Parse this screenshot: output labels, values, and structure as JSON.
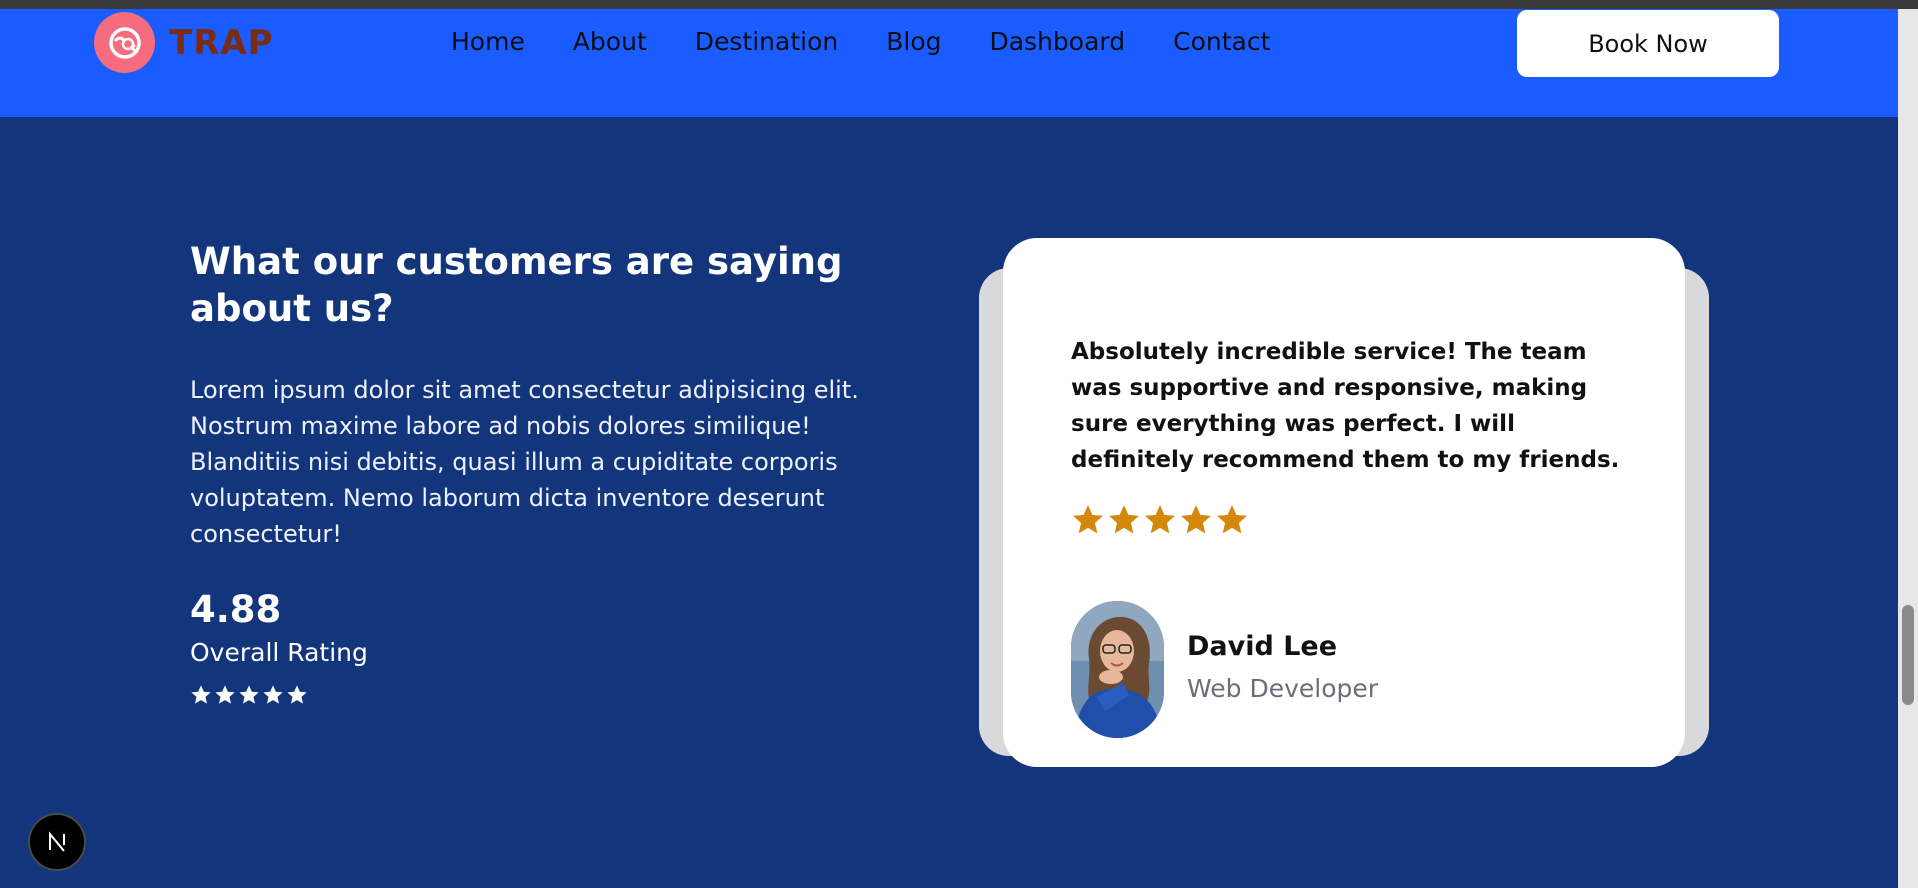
{
  "navbar": {
    "brand": "TRAP",
    "links": [
      "Home",
      "About",
      "Destination",
      "Blog",
      "Dashboard",
      "Contact"
    ],
    "cta": "Book Now"
  },
  "testimonials": {
    "heading": "What our customers are saying about us?",
    "description": "Lorem ipsum dolor sit amet consectetur adipisicing elit. Nostrum maxime labore ad nobis dolores similique! Blanditiis nisi debitis, quasi illum a cupiditate corporis voluptatem. Nemo laborum dicta inventore deserunt consectetur!",
    "rating": "4.88",
    "rating_label": "Overall Rating",
    "rating_stars": 5,
    "review": {
      "quote": "Absolutely incredible service! The team was supportive and responsive, making sure everything was perfect. I will definitely recommend them to my friends.",
      "stars": 5,
      "name": "David Lee",
      "role": "Web Developer"
    }
  },
  "colors": {
    "navbar": "#1a5cff",
    "background": "#13357b",
    "star_gold": "#d4880b",
    "logo": "#f56c7e"
  },
  "icons": {
    "logo": "travel-search-icon",
    "framework_badge": "n-logo-icon"
  }
}
